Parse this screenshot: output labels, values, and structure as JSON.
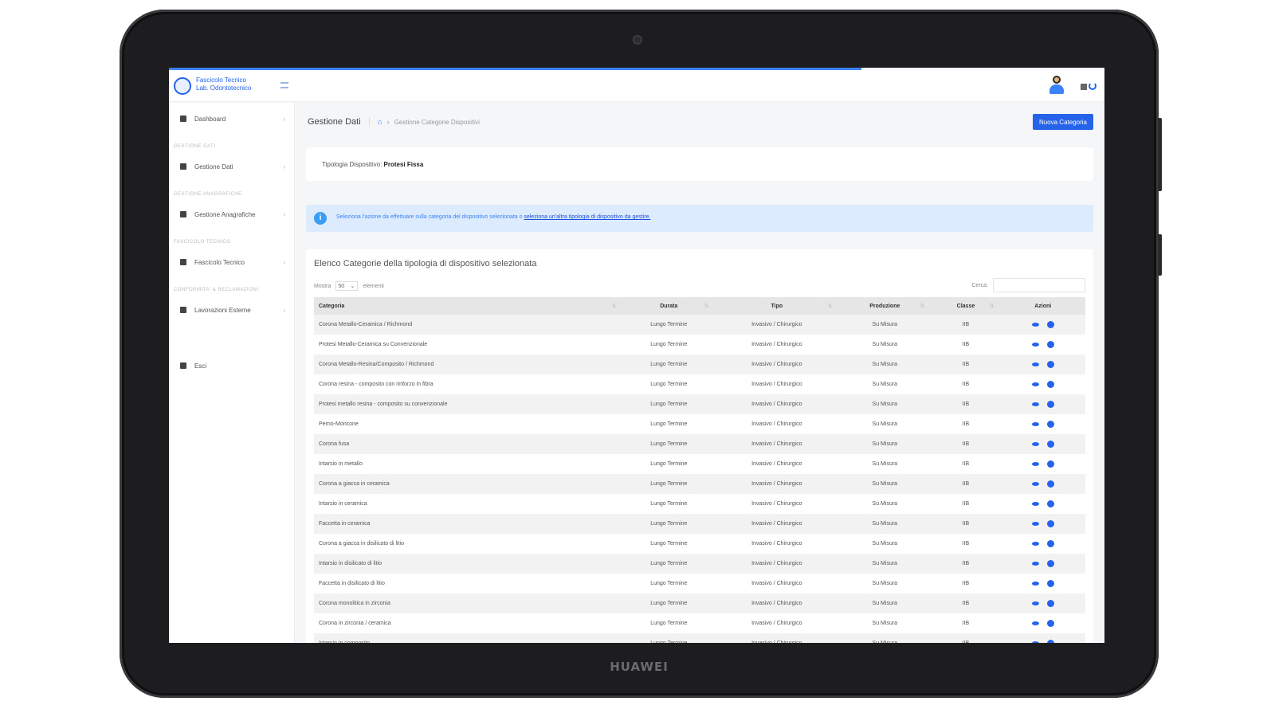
{
  "device": {
    "brand": "HUAWEI"
  },
  "header": {
    "logo_line1": "Fascicolo Tecnico",
    "logo_line2": "Lab. Odontotecnico"
  },
  "sidebar": {
    "items": [
      {
        "label": "Dashboard",
        "icon": "home-icon"
      },
      {
        "section": "GESTIONE DATI",
        "label": "Gestione Dati",
        "icon": "user-icon"
      },
      {
        "section": "GESTIONE ANAGRAFICHE",
        "label": "Gestione Anagrafiche",
        "icon": "book-icon"
      },
      {
        "section": "FASCICOLO TECNICO",
        "label": "Fascicolo Tecnico",
        "icon": "folder-icon"
      },
      {
        "section": "CONFORMITA' & RECLAMAZIONI",
        "label": "Lavorazioni Esterne",
        "icon": "clipboard-icon"
      },
      {
        "label": "Esci",
        "icon": "lock-icon"
      }
    ]
  },
  "page": {
    "title": "Gestione Dati",
    "breadcrumb": "Gestione Categorie Dispositivi",
    "new_button": "Nuova Categoria"
  },
  "type_card": {
    "label": "Tipologia Dispositivo:",
    "value": "Protesi Fissa"
  },
  "info": {
    "text": "Seleziona l'azione da effettuare sulla categoria del dispositivo selezionata o",
    "link": "seleziona un'altra tipologia di dispositivo da gestire."
  },
  "list": {
    "title": "Elenco Categorie della tipologia di dispositivo selezionata",
    "show_label": "Mostra",
    "show_value": "50",
    "elements_label": "elementi",
    "search_label": "Cerca:",
    "columns": [
      "Categoria",
      "Durata",
      "Tipo",
      "Produzione",
      "Classe",
      "Azioni"
    ],
    "rows": [
      [
        "Corona Metallo-Ceramica / Richmond",
        "Lungo Termine",
        "Invasivo / Chirurgico",
        "Su Misura",
        "IIB"
      ],
      [
        "Protesi Metallo-Ceramica su Convenzionale",
        "Lungo Termine",
        "Invasivo / Chirurgico",
        "Su Misura",
        "IIB"
      ],
      [
        "Corona Metallo-Resina/Composito / Richmond",
        "Lungo Termine",
        "Invasivo / Chirurgico",
        "Su Misura",
        "IIB"
      ],
      [
        "Corona resina - composito con rinforzo in fibra",
        "Lungo Termine",
        "Invasivo / Chirurgico",
        "Su Misura",
        "IIB"
      ],
      [
        "Protesi metallo resina - composito su convenzionale",
        "Lungo Termine",
        "Invasivo / Chirurgico",
        "Su Misura",
        "IIB"
      ],
      [
        "Perno-Moncone",
        "Lungo Termine",
        "Invasivo / Chirurgico",
        "Su Misura",
        "IIB"
      ],
      [
        "Corona fusa",
        "Lungo Termine",
        "Invasivo / Chirurgico",
        "Su Misura",
        "IIB"
      ],
      [
        "Intarsio in metallo",
        "Lungo Termine",
        "Invasivo / Chirurgico",
        "Su Misura",
        "IIB"
      ],
      [
        "Corona a giacca in ceramica",
        "Lungo Termine",
        "Invasivo / Chirurgico",
        "Su Misura",
        "IIB"
      ],
      [
        "Intarsio in ceramica",
        "Lungo Termine",
        "Invasivo / Chirurgico",
        "Su Misura",
        "IIB"
      ],
      [
        "Faccetta in ceramica",
        "Lungo Termine",
        "Invasivo / Chirurgico",
        "Su Misura",
        "IIB"
      ],
      [
        "Corona a giacca in disilicato di litio",
        "Lungo Termine",
        "Invasivo / Chirurgico",
        "Su Misura",
        "IIB"
      ],
      [
        "Intarsio in disilicato di litio",
        "Lungo Termine",
        "Invasivo / Chirurgico",
        "Su Misura",
        "IIB"
      ],
      [
        "Faccetta in disilicato di litio",
        "Lungo Termine",
        "Invasivo / Chirurgico",
        "Su Misura",
        "IIB"
      ],
      [
        "Corona monolitica in zirconia",
        "Lungo Termine",
        "Invasivo / Chirurgico",
        "Su Misura",
        "IIB"
      ],
      [
        "Corona in zirconia / ceramica",
        "Lungo Termine",
        "Invasivo / Chirurgico",
        "Su Misura",
        "IIB"
      ],
      [
        "Intarsio in composito",
        "Lungo Termine",
        "Invasivo / Chirurgico",
        "Su Misura",
        "IIB"
      ]
    ]
  },
  "colors": {
    "accent": "#2563eb",
    "info_bg": "#dcebfd",
    "bezel": "#1d1d1f"
  }
}
